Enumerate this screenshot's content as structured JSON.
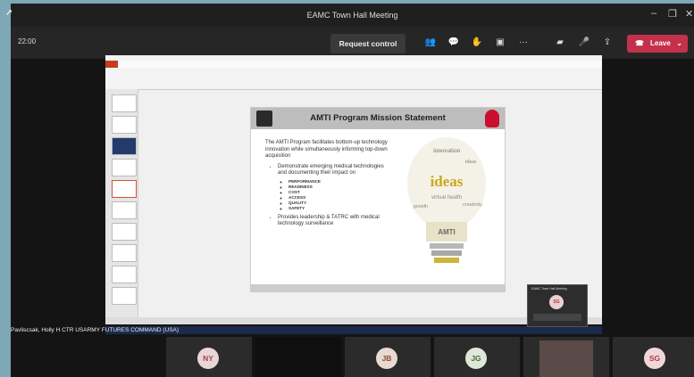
{
  "window": {
    "title": "EAMC Town Hall Meeting"
  },
  "toolbar": {
    "timer": "22:00",
    "request_control": "Request control",
    "leave": "Leave"
  },
  "presenter": {
    "name": "Pavliscsak, Holly H CTR USARMY FUTURES COMMAND (USA)"
  },
  "slide": {
    "title": "AMTI Program Mission Statement",
    "intro": "The AMTI Program facilitates bottom-up technology innovation while simultaneously informing top-down acquisition",
    "bullet1": "Demonstrate emerging medical technologies and documenting their impact on",
    "subitems": [
      "PERFORMANCE",
      "READINESS",
      "COST",
      "ACCESS",
      "QUALITY",
      "SAFETY"
    ],
    "bullet2": "Provides leadership & TATRC with medical technology surveillance",
    "bulb_words": [
      "ideas",
      "innovation",
      "creativity",
      "growth",
      "virtual health",
      "AMTI"
    ]
  },
  "mini_window": {
    "title": "EAMC Town Hall Meeting",
    "initials": "SG"
  },
  "participants": [
    {
      "initials": "NY",
      "bg": "#e8d6d6",
      "fg": "#a8434b"
    },
    {
      "initials": "",
      "bg": "#1a1a1a",
      "fg": "#ffffff"
    },
    {
      "initials": "JB",
      "bg": "#e8d9d2",
      "fg": "#8a4a36"
    },
    {
      "initials": "JG",
      "bg": "#dfe7d8",
      "fg": "#4a6b3a"
    },
    {
      "initials": "",
      "bg": "#3a3030",
      "fg": "#ffffff"
    },
    {
      "initials": "SG",
      "bg": "#f0d7d7",
      "fg": "#b03a4a"
    }
  ],
  "colors": {
    "leave": "#c4314b",
    "ppt_accent": "#d35230"
  }
}
